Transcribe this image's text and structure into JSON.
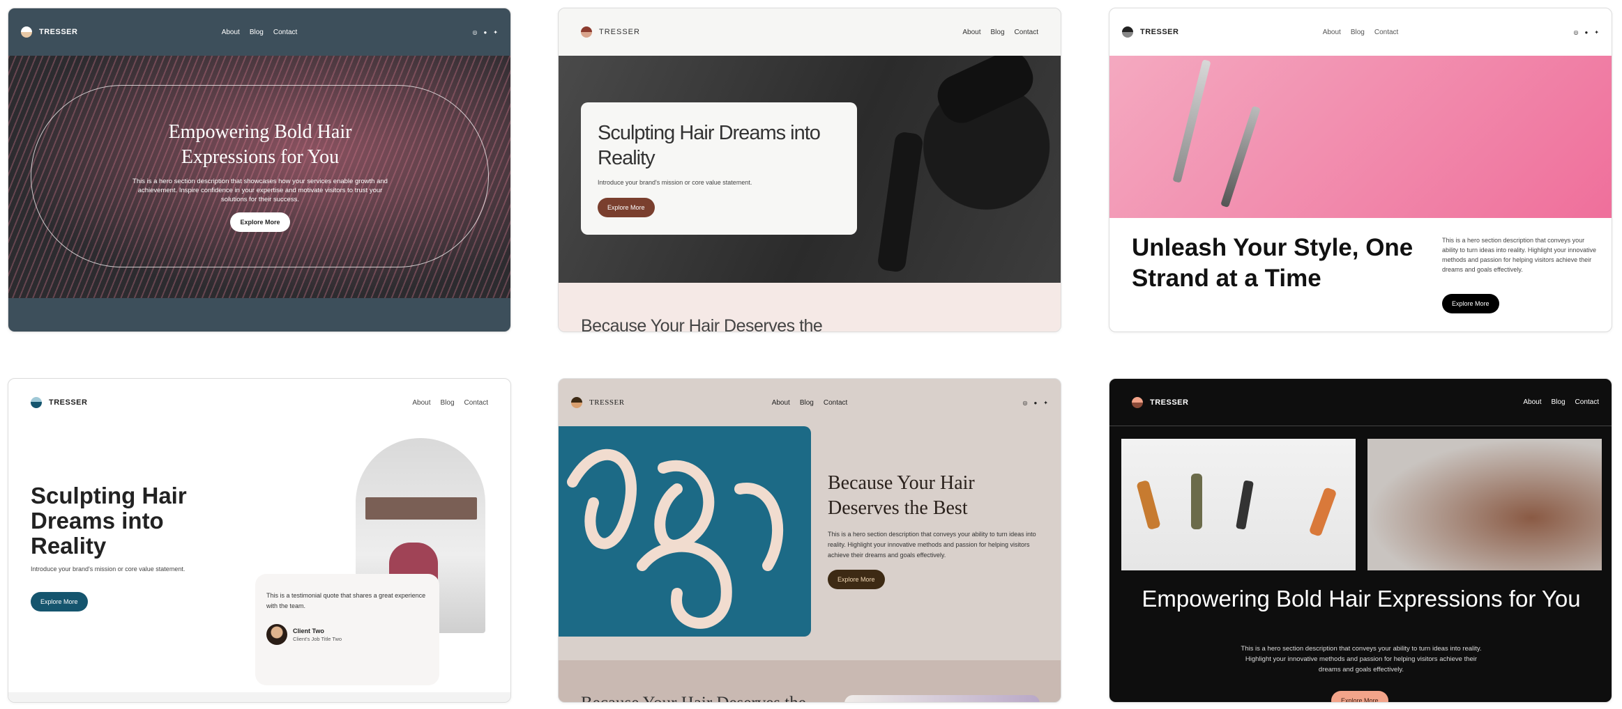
{
  "brand": "TRESSER",
  "nav": {
    "about": "About",
    "blog": "Blog",
    "contact": "Contact"
  },
  "social": {
    "instagram": "◎",
    "facebook": "●",
    "twitter": "✦"
  },
  "cards": {
    "c1": {
      "title": "Empowering Bold Hair Expressions for You",
      "desc": "This is a hero section description that showcases how your services enable growth and achievement. Inspire confidence in your expertise and motivate visitors to trust your solutions for their success.",
      "button": "Explore More"
    },
    "c2": {
      "title": "Sculpting Hair Dreams into Reality",
      "desc": "Introduce your brand's mission or core value statement.",
      "button": "Explore More",
      "next_section": "Because Your Hair Deserves the"
    },
    "c3": {
      "title": "Unleash Your Style, One Strand at a Time",
      "desc": "This is a hero section description that conveys your ability to turn ideas into reality. Highlight your innovative methods and passion for helping visitors achieve their dreams and goals effectively.",
      "button": "Explore More"
    },
    "c4": {
      "title": "Sculpting Hair Dreams into Reality",
      "desc": "Introduce your brand's mission or core value statement.",
      "button": "Explore More",
      "quote": "This is a testimonial quote that shares a great experience with the team.",
      "client_name": "Client Two",
      "client_title": "Client's Job Title Two"
    },
    "c5": {
      "title": "Because Your Hair Deserves the Best",
      "desc": "This is a hero section description that conveys your ability to turn ideas into reality. Highlight your innovative methods and passion for helping visitors achieve their dreams and goals effectively.",
      "button": "Explore More",
      "next_section": "Because Your Hair Deserves the"
    },
    "c6": {
      "title": "Empowering Bold Hair Expressions for You",
      "desc": "This is a hero section description that conveys your ability to turn ideas into reality. Highlight your innovative methods and passion for helping visitors achieve their dreams and goals effectively.",
      "button": "Explore More"
    }
  },
  "colors": {
    "c2_button": "#7a3f2e",
    "c4_button": "#15556e",
    "c5_button": "#3d2a14",
    "c6_button": "#f3a48a"
  }
}
